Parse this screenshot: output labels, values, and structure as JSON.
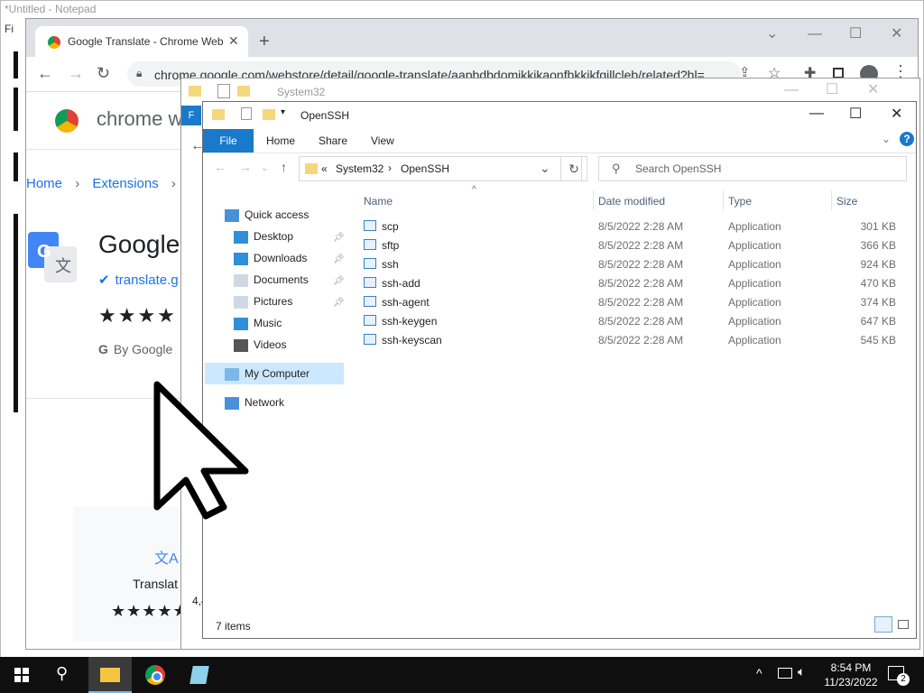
{
  "notepad": {
    "title": "*Untitled - Notepad",
    "menu_initial": "Fi"
  },
  "chrome": {
    "tab_title": "Google Translate - Chrome Web",
    "tab_close": "✕",
    "new_tab": "+",
    "url": "chrome.google.com/webstore/detail/google-translate/aapbdbdomjkkjkaonfhkkikfgjllcleb/related?hl=...",
    "store": {
      "title": "chrome w",
      "breadcrumbs": [
        "Home",
        "Extensions"
      ],
      "extension_name": "Google",
      "site": "translate.g",
      "stars": "★★★★",
      "by": "By Google",
      "card_label": "Translat",
      "card_stars": "★★★★★",
      "rating_count_fragment": "4,4"
    }
  },
  "ghost_window": {
    "title": "System32"
  },
  "explorer": {
    "title": "OpenSSH",
    "ribbon": {
      "file": "File",
      "tabs": [
        "Home",
        "Share",
        "View"
      ]
    },
    "address": {
      "chevron": "«",
      "parts": [
        "System32",
        "OpenSSH"
      ]
    },
    "search_placeholder": "Search OpenSSH",
    "nav": [
      {
        "label": "Quick access",
        "icon": "star-icon",
        "pinned": false
      },
      {
        "label": "Desktop",
        "icon": "desktop-icon",
        "pinned": true
      },
      {
        "label": "Downloads",
        "icon": "download-icon",
        "pinned": true
      },
      {
        "label": "Documents",
        "icon": "documents-icon",
        "pinned": true
      },
      {
        "label": "Pictures",
        "icon": "pictures-icon",
        "pinned": true
      },
      {
        "label": "Music",
        "icon": "music-icon",
        "pinned": false
      },
      {
        "label": "Videos",
        "icon": "videos-icon",
        "pinned": false
      },
      {
        "label": "My Computer",
        "icon": "computer-icon",
        "pinned": false,
        "selected": true
      },
      {
        "label": "Network",
        "icon": "network-icon",
        "pinned": false
      }
    ],
    "columns": {
      "name": "Name",
      "date": "Date modified",
      "type": "Type",
      "size": "Size"
    },
    "files": [
      {
        "name": "scp",
        "date": "8/5/2022 2:28 AM",
        "type": "Application",
        "size": "301 KB"
      },
      {
        "name": "sftp",
        "date": "8/5/2022 2:28 AM",
        "type": "Application",
        "size": "366 KB"
      },
      {
        "name": "ssh",
        "date": "8/5/2022 2:28 AM",
        "type": "Application",
        "size": "924 KB"
      },
      {
        "name": "ssh-add",
        "date": "8/5/2022 2:28 AM",
        "type": "Application",
        "size": "470 KB"
      },
      {
        "name": "ssh-agent",
        "date": "8/5/2022 2:28 AM",
        "type": "Application",
        "size": "374 KB"
      },
      {
        "name": "ssh-keygen",
        "date": "8/5/2022 2:28 AM",
        "type": "Application",
        "size": "647 KB"
      },
      {
        "name": "ssh-keyscan",
        "date": "8/5/2022 2:28 AM",
        "type": "Application",
        "size": "545 KB"
      }
    ],
    "status": "7 items"
  },
  "taskbar": {
    "time": "8:54 PM",
    "date": "11/23/2022",
    "notifications": "2"
  },
  "colors": {
    "accent": "#1979ca",
    "selection": "#cce8ff",
    "taskbar": "#0f0f0f",
    "link": "#1a73e8"
  }
}
